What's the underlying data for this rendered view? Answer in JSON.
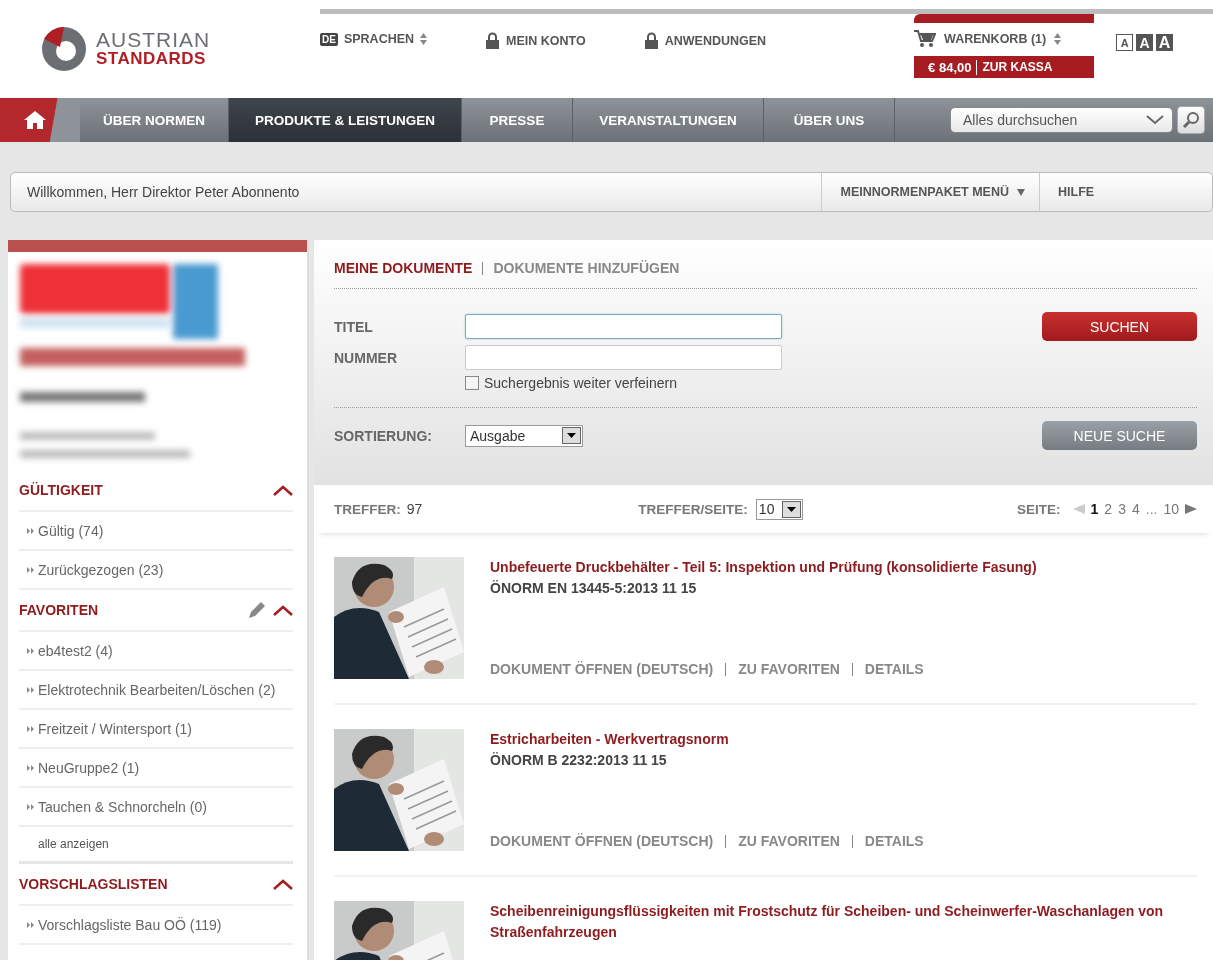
{
  "logo": {
    "line1": "AUSTRIAN",
    "line2": "STANDARDS"
  },
  "top_links": [
    {
      "kind": "language",
      "badge": "DE",
      "label": "SPRACHEN"
    },
    {
      "kind": "lock",
      "label": "MEIN KONTO"
    },
    {
      "kind": "lock",
      "label": "ANWENDUNGEN"
    }
  ],
  "cart": {
    "label": "WARENKORB (1)",
    "total": "€ 84,00",
    "checkout": "ZUR KASSA"
  },
  "font_sizes": [
    {
      "label": "A",
      "selected": false
    },
    {
      "label": "A",
      "selected": true
    },
    {
      "label": "A",
      "selected": true
    }
  ],
  "nav": {
    "items": [
      {
        "label": "ÜBER NORMEN",
        "selected": false
      },
      {
        "label": "PRODUKTE & LEISTUNGEN",
        "selected": true
      },
      {
        "label": "PRESSE",
        "selected": false
      },
      {
        "label": "VERANSTALTUNGEN",
        "selected": false
      },
      {
        "label": "ÜBER UNS",
        "selected": false
      }
    ],
    "search": {
      "placeholder": "Alles durchsuchen"
    }
  },
  "welcome": {
    "text": "Willkommen, Herr Direktor Peter Abonnento",
    "menu": "MEINNORMENPAKET MENÜ",
    "help": "HILFE"
  },
  "sidebar": {
    "sections": [
      {
        "title": "GÜLTIGKEIT",
        "expanded": true,
        "editable": false,
        "items": [
          "Gültig (74)",
          "Zurückgezogen (23)"
        ]
      },
      {
        "title": "FAVORITEN",
        "expanded": true,
        "editable": true,
        "items": [
          "eb4test2 (4)",
          "Elektrotechnik Bearbeiten/Löschen (2)",
          "Freitzeit / Wintersport (1)",
          "NeuGruppe2 (1)",
          "Tauchen & Schnorcheln (0)"
        ],
        "more": "alle anzeigen"
      },
      {
        "title": "VORSCHLAGSLISTEN",
        "expanded": true,
        "editable": false,
        "items": [
          "Vorschlagsliste Bau OÖ (119)"
        ]
      }
    ]
  },
  "main": {
    "tabs": [
      {
        "label": "MEINE DOKUMENTE",
        "selected": true
      },
      {
        "label": "DOKUMENTE HINZUFÜGEN",
        "selected": false
      }
    ],
    "form": {
      "title_label": "TITEL",
      "title_focused": true,
      "number_label": "NUMMER",
      "refine": {
        "label": "Suchergebnis weiter verfeinern",
        "checked": false
      },
      "search_button": "SUCHEN",
      "sort_label": "SORTIERUNG:",
      "sort_value": "Ausgabe",
      "new_search": "NEUE SUCHE"
    },
    "results": {
      "hits_label": "TREFFER:",
      "hits": "97",
      "per_page_label": "TREFFER/SEITE:",
      "per_page": "10",
      "page_label": "SEITE:",
      "pages": [
        {
          "kind": "page",
          "label": "1",
          "selected": true
        },
        {
          "kind": "page",
          "label": "2",
          "selected": false
        },
        {
          "kind": "page",
          "label": "3",
          "selected": false
        },
        {
          "kind": "page",
          "label": "4",
          "selected": false
        },
        {
          "kind": "ellipsis",
          "label": "..."
        },
        {
          "kind": "page",
          "label": "10",
          "selected": false
        }
      ]
    },
    "documents": [
      {
        "title": "Unbefeuerte Druckbehälter - Teil 5: Inspektion und Prüfung (konsolidierte Fasung)",
        "number": "ÖNORM EN 13445-5:2013 11 15",
        "actions": [
          "DOKUMENT ÖFFNEN (DEUTSCH)",
          "ZU FAVORITEN",
          "DETAILS"
        ]
      },
      {
        "title": "Estricharbeiten - Werkvertragsnorm",
        "number": "ÖNORM B 2232:2013 11 15",
        "actions": [
          "DOKUMENT ÖFFNEN (DEUTSCH)",
          "ZU FAVORITEN",
          "DETAILS"
        ]
      },
      {
        "title": "Scheibenreinigungsflüssigkeiten mit Frostschutz für Scheiben- und Scheinwerfer-Waschanlagen von Straßenfahrzeugen"
      }
    ]
  }
}
